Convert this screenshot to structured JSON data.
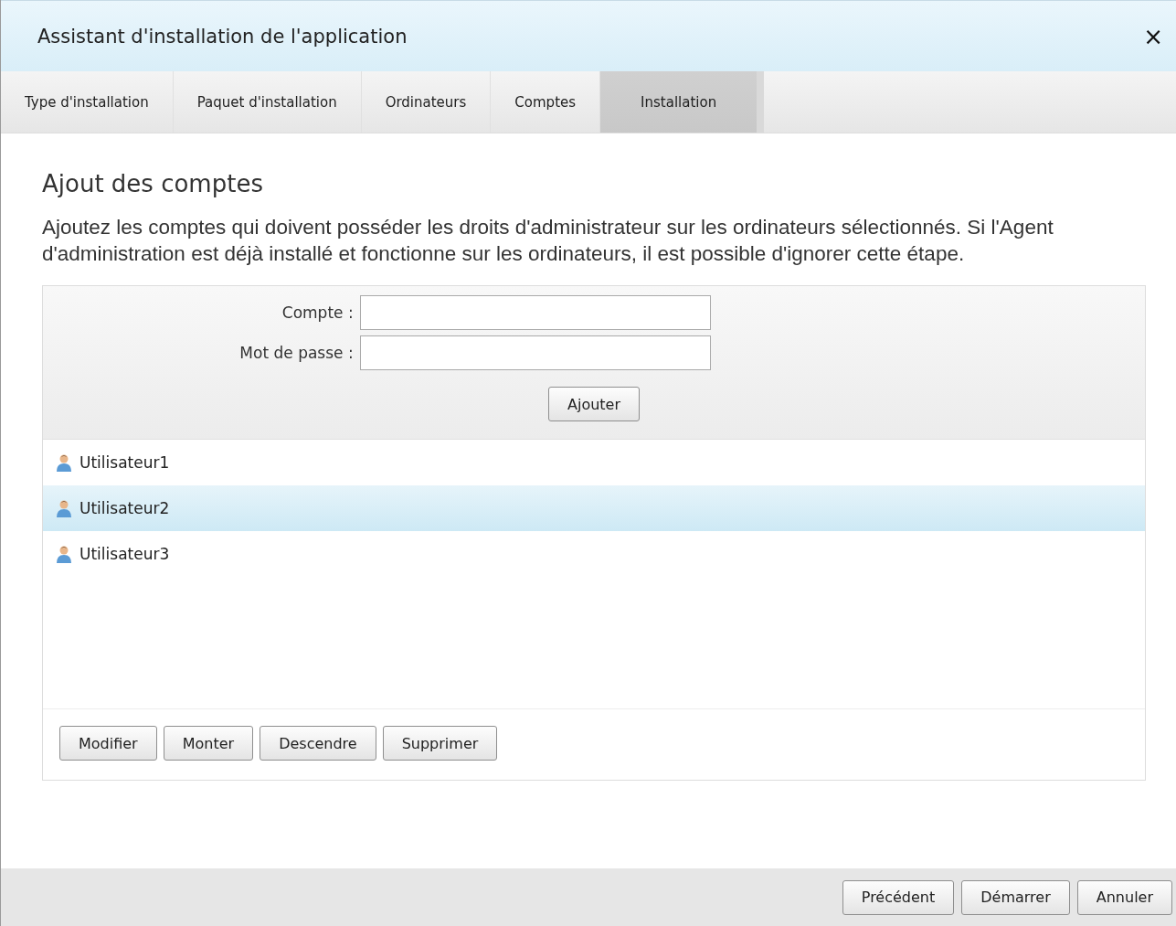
{
  "window": {
    "title": "Assistant d'installation de l'application",
    "close": "×"
  },
  "steps": [
    {
      "label": "Type d'installation",
      "selected": false
    },
    {
      "label": "Paquet d'installation",
      "selected": false
    },
    {
      "label": "Ordinateurs",
      "selected": false
    },
    {
      "label": "Comptes",
      "selected": false
    },
    {
      "label": "Installation",
      "selected": true
    }
  ],
  "heading": "Ajout des comptes",
  "description": "Ajoutez les comptes qui doivent posséder les droits d'administrateur sur les ordinateurs sélectionnés. Si l'Agent d'administration est déjà installé et fonctionne sur les ordinateurs, il est possible d'ignorer cette étape.",
  "form": {
    "fields": [
      {
        "label": "Compte :"
      },
      {
        "label": "Mot de passe :"
      }
    ],
    "add_button": "Ajouter"
  },
  "accounts": [
    {
      "name": "Utilisateur1",
      "selected": false
    },
    {
      "name": "Utilisateur2",
      "selected": true
    },
    {
      "name": "Utilisateur3",
      "selected": false
    }
  ],
  "list_buttons": [
    "Modifier",
    "Monter",
    "Descendre",
    "Supprimer"
  ],
  "footer_buttons": [
    "Précédent",
    "Démarrer",
    "Annuler"
  ]
}
